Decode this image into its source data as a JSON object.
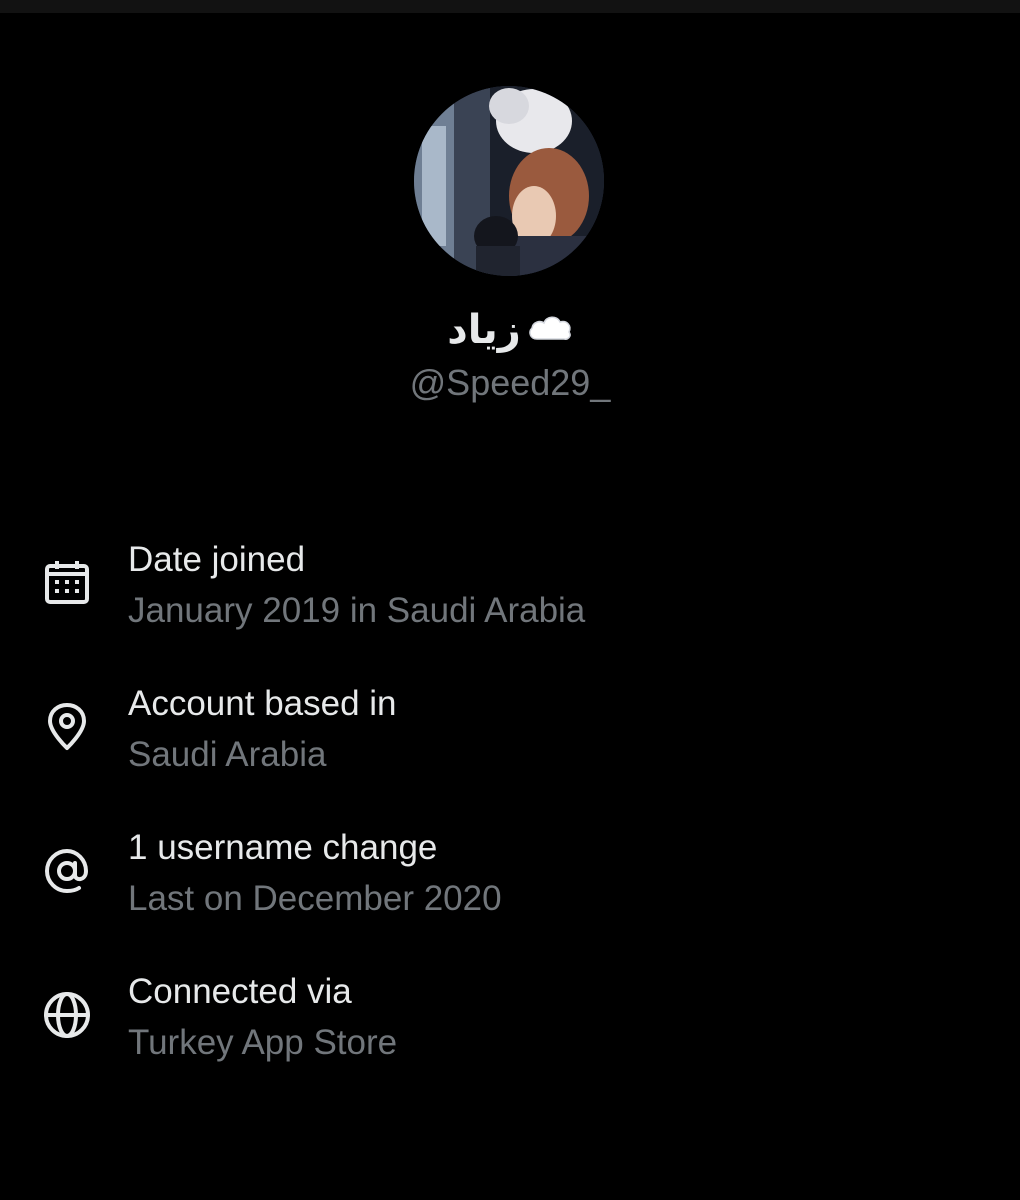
{
  "profile": {
    "display_name": "زياد",
    "name_emoji_icon": "cloud-emoji-icon",
    "handle": "@Speed29_",
    "avatar_description": "profile photo"
  },
  "info": {
    "items": [
      {
        "icon": "calendar-icon",
        "title": "Date joined",
        "subtitle": "January 2019 in Saudi Arabia"
      },
      {
        "icon": "location-pin-icon",
        "title": "Account based in",
        "subtitle": "Saudi Arabia"
      },
      {
        "icon": "at-sign-icon",
        "title": "1 username change",
        "subtitle": "Last on December 2020"
      },
      {
        "icon": "globe-icon",
        "title": "Connected via",
        "subtitle": "Turkey App Store"
      }
    ]
  },
  "colors": {
    "background": "#000000",
    "primary_text": "#e7e9ea",
    "secondary_text": "#71767b"
  }
}
